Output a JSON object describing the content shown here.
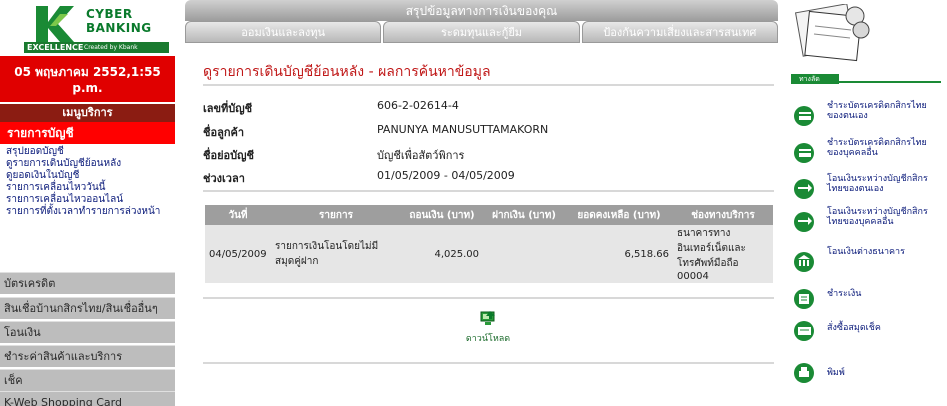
{
  "brand": {
    "word1": "CYBER",
    "word2": "BANKING",
    "tagline": "EXCELLENCE",
    "subtag": "Created by Kbank"
  },
  "session": {
    "datetime": "05 พฤษภาคม 2552,1:55 p.m."
  },
  "sidebar": {
    "menu_title": "เมนูบริการ",
    "active_item": "รายการบัญชี",
    "sub_items": [
      "สรุปยอดบัญชี",
      "ดูรายการเดินบัญชีย้อนหลัง",
      "ดูยอดเงินในบัญชี",
      "รายการเคลื่อนไหววันนี้",
      "รายการเคลื่อนไหวออนไลน์",
      "รายการที่ตั้งเวลาทำรายการล่วงหน้า"
    ],
    "sections": [
      "บัตรเครดิต",
      "สินเชื่อบ้านกสิกรไทย/สินเชื่ออื่นๆ",
      "โอนเงิน",
      "ชำระค่าสินค้าและบริการ",
      "เช็ค",
      "K-Web Shopping Card"
    ]
  },
  "header": {
    "title": "สรุปข้อมูลทางการเงินของคุณ",
    "tabs": [
      "ออมเงินและลงทุน",
      "ระดมทุนและกู้ยืม",
      "ป้องกันความเสี่ยงและสารสนเทศ"
    ]
  },
  "main": {
    "page_title": "ดูรายการเดินบัญชีย้อนหลัง - ผลการค้นหาข้อมูล",
    "info": [
      {
        "label": "เลขที่บัญชี",
        "value": "606-2-02614-4"
      },
      {
        "label": "ชื่อลูกค้า",
        "value": "PANUNYA MANUSUTTAMAKORN"
      },
      {
        "label": "ชื่อย่อบัญชี",
        "value": "บัญชีเพื่อสัตว์พิการ"
      },
      {
        "label": "ช่วงเวลา",
        "value": "01/05/2009 - 04/05/2009"
      }
    ],
    "table": {
      "headers": [
        "วันที่",
        "รายการ",
        "ถอนเงิน (บาท)",
        "ฝากเงิน (บาท)",
        "ยอดคงเหลือ (บาท)",
        "ช่องทางบริการ"
      ],
      "rows": [
        [
          "04/05/2009",
          "รายการเงินโอนโดยไม่มีสมุดคู่ฝาก",
          "4,025.00",
          "",
          "6,518.66",
          "ธนาคารทางอินเทอร์เน็ตและโทรศัพท์มือถือ 00004"
        ]
      ]
    },
    "download_label": "ดาวน์โหลด"
  },
  "shortcuts": {
    "label": "ทางลัด",
    "items": [
      "ชำระบัตรเครดิตกสิกรไทยของตนเอง",
      "ชำระบัตรเครดิตกสิกรไทยของบุคคลอื่น",
      "โอนเงินระหว่างบัญชีกสิกรไทยของตนเอง",
      "โอนเงินระหว่างบัญชีกสิกรไทยของบุคคลอื่น",
      "โอนเงินต่างธนาคาร",
      "ชำระเงิน",
      "สั่งซื้อสมุดเช็ค",
      "พิมพ์"
    ]
  },
  "colors": {
    "accent_red": "#e00000",
    "menu_title_bg": "#8b1c12",
    "brand_green": "#1a7a2f",
    "title_red": "#c01818"
  }
}
